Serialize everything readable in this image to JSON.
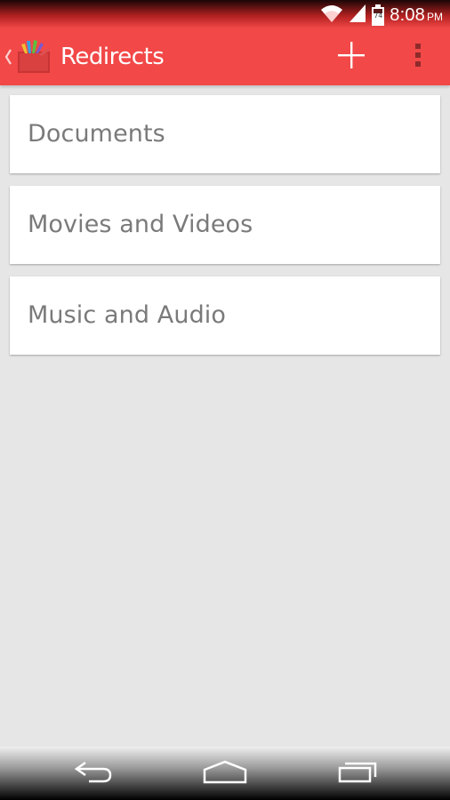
{
  "status_bar": {
    "time": "8:08",
    "ampm": "PM",
    "battery_level": "74",
    "icons": [
      "wifi-icon",
      "signal-icon",
      "battery-icon"
    ]
  },
  "action_bar": {
    "title": "Redirects",
    "background_color": "#f24848",
    "icons": [
      "up-chevron-icon",
      "app-logo-icon",
      "add-icon",
      "overflow-menu-icon"
    ]
  },
  "list": {
    "items": [
      {
        "label": "Documents"
      },
      {
        "label": "Movies and Videos"
      },
      {
        "label": "Music and Audio"
      }
    ]
  },
  "nav_bar": {
    "icons": [
      "back-icon",
      "home-icon",
      "recent-apps-icon"
    ]
  },
  "colors": {
    "accent": "#f24848",
    "background": "#e6e6e6",
    "card": "#ffffff",
    "text_secondary": "#7a7a7a"
  }
}
